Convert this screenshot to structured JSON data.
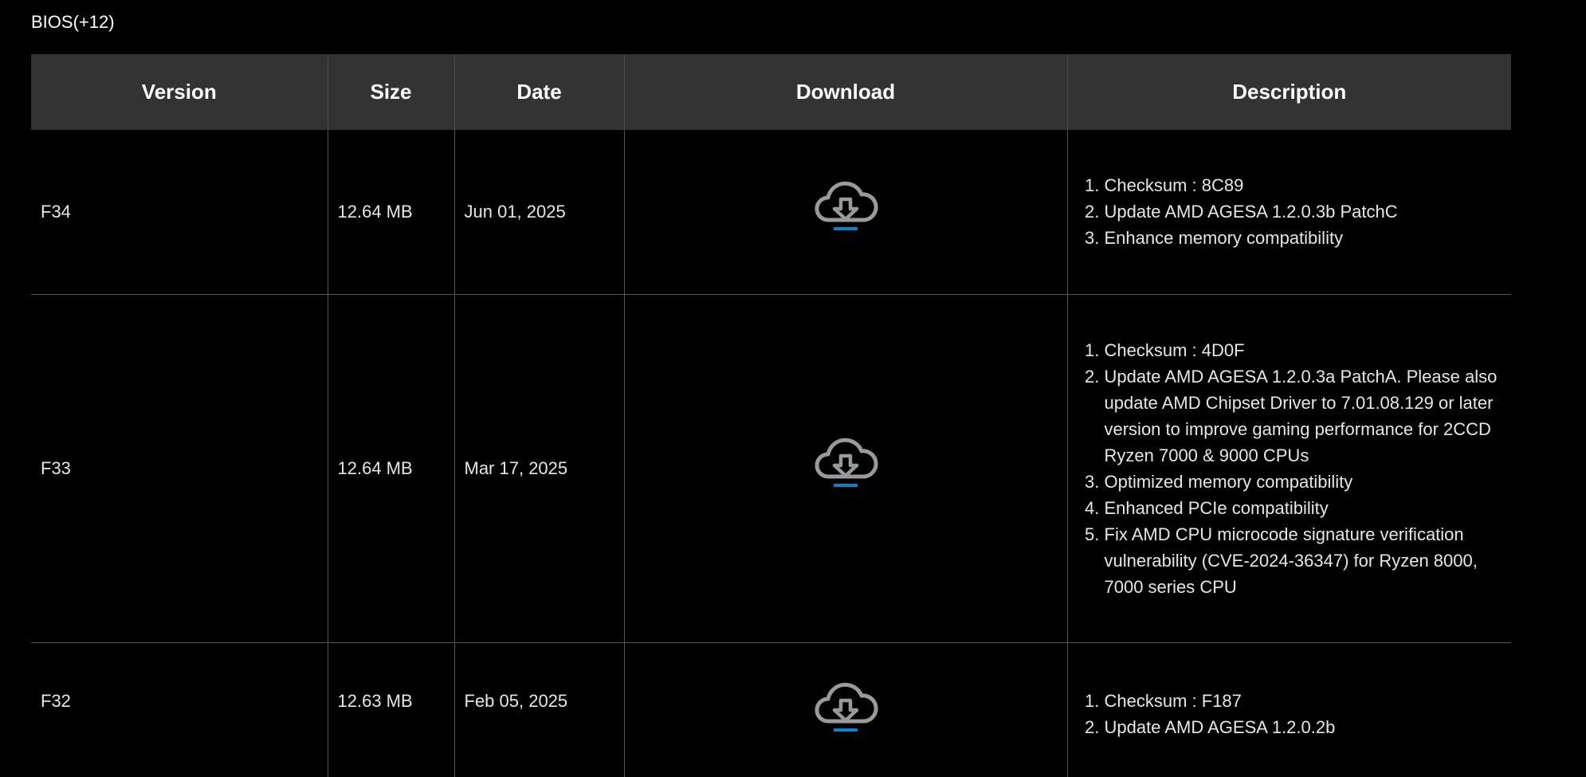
{
  "section": {
    "label": "BIOS(+12)"
  },
  "table": {
    "headers": [
      "Version",
      "Size",
      "Date",
      "Download",
      "Description"
    ],
    "rows": [
      {
        "version": "F34",
        "size": "12.64 MB",
        "date": "Jun 01, 2025",
        "download_icon": "cloud-download-icon",
        "description": [
          "Checksum : 8C89",
          "Update AMD AGESA 1.2.0.3b PatchC",
          "Enhance memory compatibility"
        ]
      },
      {
        "version": "F33",
        "size": "12.64 MB",
        "date": "Mar 17, 2025",
        "download_icon": "cloud-download-icon",
        "description": [
          "Checksum : 4D0F",
          "Update AMD AGESA 1.2.0.3a PatchA. Please also update AMD Chipset Driver to 7.01.08.129 or later version to improve gaming performance for 2CCD Ryzen 7000 & 9000 CPUs",
          "Optimized memory compatibility",
          "Enhanced PCIe compatibility",
          "Fix AMD CPU microcode signature verification vulnerability (CVE-2024-36347) for Ryzen 8000, 7000 series CPU"
        ]
      },
      {
        "version": "F32",
        "size": "12.63 MB",
        "date": "Feb 05, 2025",
        "download_icon": "cloud-download-icon",
        "description": [
          "Checksum : F187",
          "Update AMD AGESA 1.2.0.2b"
        ]
      }
    ]
  },
  "colors": {
    "background": "#000000",
    "header_bg": "#333333",
    "icon_gray": "#9a9a9a",
    "icon_accent": "#0a84c8"
  }
}
